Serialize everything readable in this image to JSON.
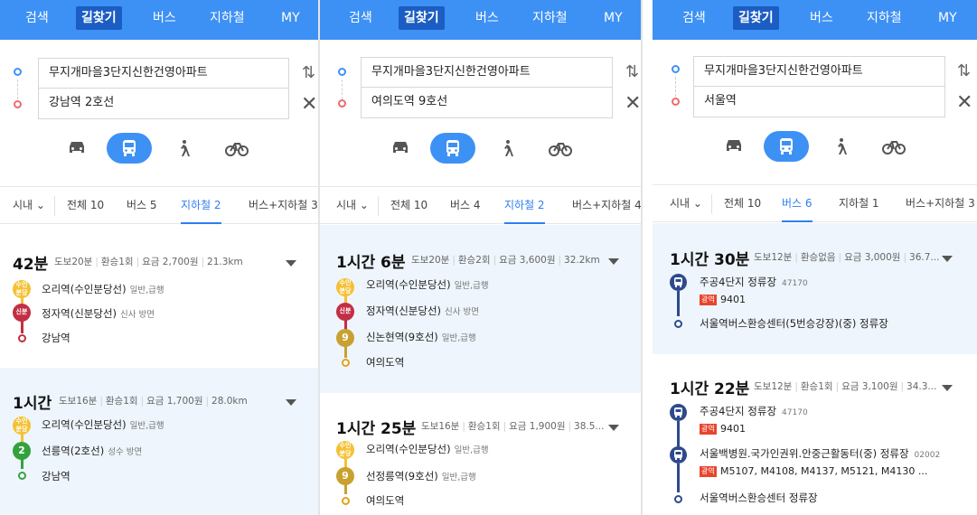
{
  "colors": {
    "accent": "#3d91f5",
    "accent_dark": "#1b5dc2",
    "suin_bundang": "#f5c033",
    "shinbundang": "#c22e43",
    "line2": "#33a23d",
    "line9": "#c8a130",
    "bus_badge": "#2e4a8c",
    "express_tag": "#e8452c"
  },
  "panels": [
    {
      "top_tabs": [
        "검색",
        "길찾기",
        "버스",
        "지하철",
        "MY"
      ],
      "active_top_tab": "길찾기",
      "origin": "무지개마을3단지신한건영아파트",
      "destination": "강남역 2호선",
      "modes": [
        "car",
        "bus",
        "walk",
        "bike"
      ],
      "active_mode": "bus",
      "filter": {
        "region": "시내",
        "tabs": [
          "전체 10",
          "버스 5",
          "지하철 2",
          "버스+지하철 3"
        ],
        "active": "지하철 2"
      },
      "routes": [
        {
          "time": "42분",
          "meta": [
            "도보20분",
            "환승1회",
            "요금 2,700원",
            "21.3km"
          ],
          "steps": [
            {
              "badge": "수인\n분당",
              "line": "suin",
              "name": "오리역(수인분당선)",
              "sub": "일반,급행"
            },
            {
              "badge": "신분",
              "line": "shin",
              "name": "정자역(신분당선)",
              "sub": "신사 방면"
            },
            {
              "badge": "",
              "line": "shin-end",
              "name": "강남역",
              "sub": ""
            }
          ]
        },
        {
          "time": "1시간",
          "meta": [
            "도보16분",
            "환승1회",
            "요금 1,700원",
            "28.0km"
          ],
          "steps": [
            {
              "badge": "수인\n분당",
              "line": "suin",
              "name": "오리역(수인분당선)",
              "sub": "일반,급행"
            },
            {
              "badge": "2",
              "line": "line2",
              "name": "선릉역(2호선)",
              "sub": "성수 방면"
            },
            {
              "badge": "",
              "line": "line2-end",
              "name": "강남역",
              "sub": ""
            }
          ]
        }
      ]
    },
    {
      "top_tabs": [
        "검색",
        "길찾기",
        "버스",
        "지하철",
        "MY"
      ],
      "active_top_tab": "길찾기",
      "origin": "무지개마을3단지신한건영아파트",
      "destination": "여의도역 9호선",
      "modes": [
        "car",
        "bus",
        "walk",
        "bike"
      ],
      "active_mode": "bus",
      "filter": {
        "region": "시내",
        "tabs": [
          "전체 10",
          "버스 4",
          "지하철 2",
          "버스+지하철 4"
        ],
        "active": "지하철 2"
      },
      "routes": [
        {
          "time": "1시간 6분",
          "meta": [
            "도보20분",
            "환승2회",
            "요금 3,600원",
            "32.2km"
          ],
          "steps": [
            {
              "badge": "수인\n분당",
              "line": "suin",
              "name": "오리역(수인분당선)",
              "sub": "일반,급행"
            },
            {
              "badge": "신분",
              "line": "shin",
              "name": "정자역(신분당선)",
              "sub": "신사 방면"
            },
            {
              "badge": "9",
              "line": "line9",
              "name": "신논현역(9호선)",
              "sub": "일반,급행"
            },
            {
              "badge": "",
              "line": "line9-end",
              "name": "여의도역",
              "sub": ""
            }
          ]
        },
        {
          "time": "1시간 25분",
          "meta": [
            "도보16분",
            "환승1회",
            "요금 1,900원",
            "38.5..."
          ],
          "steps": [
            {
              "badge": "수인\n분당",
              "line": "suin",
              "name": "오리역(수인분당선)",
              "sub": "일반,급행"
            },
            {
              "badge": "9",
              "line": "line9",
              "name": "선정릉역(9호선)",
              "sub": "일반,급행"
            },
            {
              "badge": "",
              "line": "line9-end",
              "name": "여의도역",
              "sub": ""
            }
          ]
        }
      ]
    },
    {
      "top_tabs": [
        "검색",
        "길찾기",
        "버스",
        "지하철",
        "MY"
      ],
      "active_top_tab": "길찾기",
      "origin": "무지개마을3단지신한건영아파트",
      "destination": "서울역",
      "modes": [
        "car",
        "bus",
        "walk",
        "bike"
      ],
      "active_mode": "bus",
      "filter": {
        "region": "시내",
        "tabs": [
          "전체 10",
          "버스 6",
          "지하철 1",
          "버스+지하철 3"
        ],
        "active": "버스 6"
      },
      "routes": [
        {
          "time": "1시간 30분",
          "meta": [
            "도보12분",
            "환승없음",
            "요금 3,000원",
            "36.7..."
          ],
          "steps": [
            {
              "stop": "주공4단지 정류장",
              "code": "47170",
              "tag": "광역",
              "bus": "9401"
            },
            {
              "stop": "서울역버스환승센터(5번승강장)(중) 정류장",
              "code": "",
              "tag": "",
              "bus": ""
            }
          ]
        },
        {
          "time": "1시간 22분",
          "meta": [
            "도보12분",
            "환승1회",
            "요금 3,100원",
            "34.3..."
          ],
          "steps": [
            {
              "stop": "주공4단지 정류장",
              "code": "47170",
              "tag": "광역",
              "bus": "9401"
            },
            {
              "stop": "서울백병원.국가인권위.안중근활동터(중) 정류장",
              "code": "02002",
              "tag": "광역",
              "bus": "M5107, M4108, M4137, M5121, M4130 ..."
            },
            {
              "stop": "서울역버스환승센터 정류장",
              "code": "",
              "tag": "",
              "bus": ""
            }
          ]
        }
      ]
    }
  ]
}
